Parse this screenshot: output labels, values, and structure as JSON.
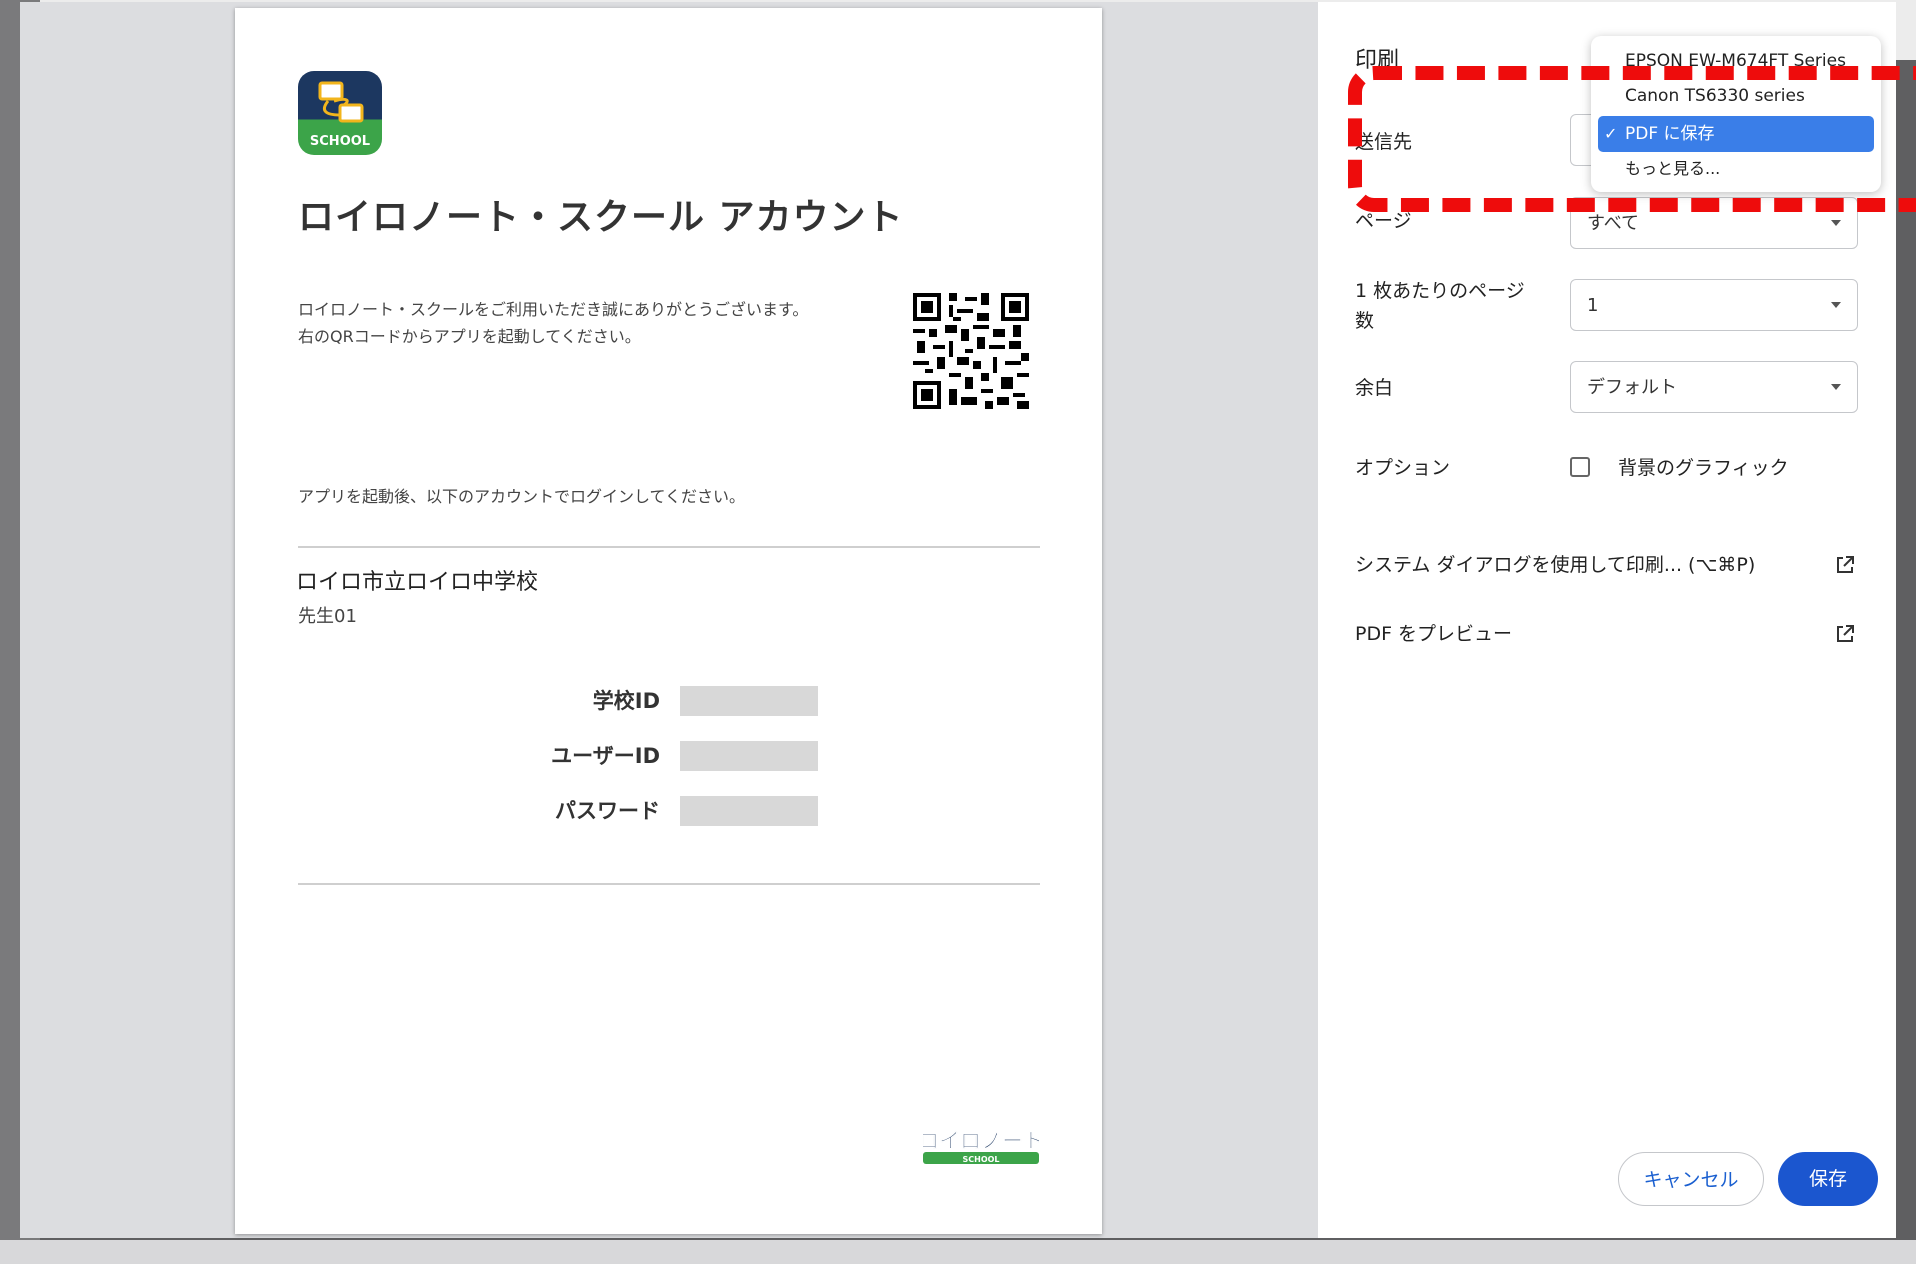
{
  "document": {
    "app_icon_label": "SCHOOL",
    "title": "ロイロノート・スクール アカウント",
    "intro_line1": "ロイロノート・スクールをご利用いただき誠にありがとうございます。",
    "intro_line2": "右のQRコードからアプリを起動してください。",
    "login_note": "アプリを起動後、以下のアカウントでログインしてください。",
    "school_name": "ロイロ市立ロイロ中学校",
    "teacher": "先生01",
    "credentials": [
      {
        "label": "学校ID"
      },
      {
        "label": "ユーザーID"
      },
      {
        "label": "パスワード"
      }
    ],
    "logo_text": "ロイロノート",
    "logo_sub": "SCHOOL"
  },
  "panel": {
    "title": "印刷",
    "destination_label": "送信先",
    "pages_label": "ページ",
    "pages_value": "すべて",
    "pages_per_sheet_label_1": "1 枚あたりのページ",
    "pages_per_sheet_label_2": "数",
    "pages_per_sheet_value": "1",
    "margins_label": "余白",
    "margins_value": "デフォルト",
    "options_label": "オプション",
    "background_graphics_label": "背景のグラフィック",
    "system_dialog_link": "システム ダイアログを使用して印刷... (⌥⌘P)",
    "pdf_preview_link": "PDF をプレビュー",
    "cancel_button": "キャンセル",
    "save_button": "保存"
  },
  "dropdown": {
    "items": [
      "EPSON EW-M674FT Series",
      "Canon TS6330 series",
      "PDF に保存",
      "もっと見る..."
    ],
    "selected_index": 2
  },
  "colors": {
    "accent": "#1b56cf",
    "selected_item": "#3a7ee8",
    "annotation": "#ee0c0c"
  }
}
